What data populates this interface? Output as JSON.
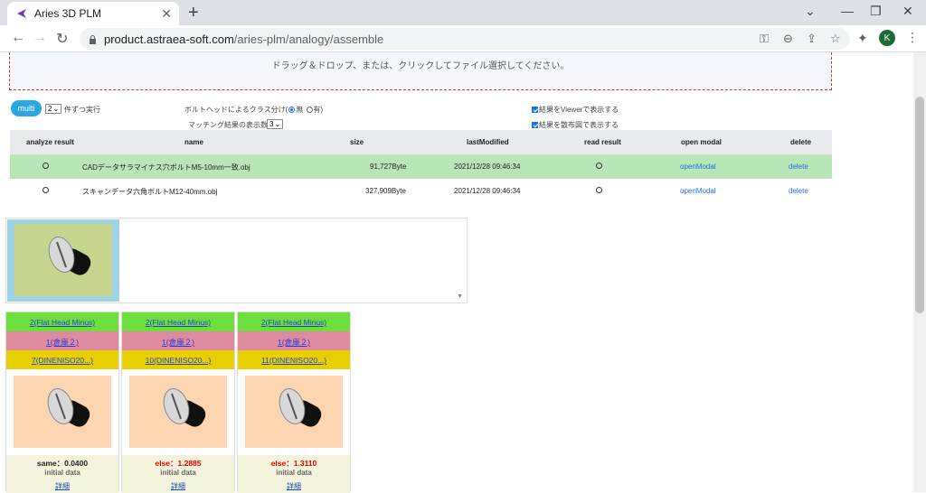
{
  "browser": {
    "tab_title": "Aries 3D PLM",
    "url_host": "product.astraea-soft.com",
    "url_path": "/aries-plm/analogy/assemble",
    "avatar_initial": "K"
  },
  "dropzone": {
    "text": "ドラッグ＆ドロップ、または、クリックしてファイル選択してください。"
  },
  "controls": {
    "multi_label": "multi",
    "batch_value": "2",
    "batch_suffix": "件ずつ実行",
    "bolt_head_label": "ボルトヘッドによるクラス分け(",
    "radio_no": "無",
    "radio_yes": "有",
    "radio_close": ")",
    "match_count_label": "マッチング結果の表示数:",
    "match_count_value": "3",
    "viewer_label": "結果をViewerで表示する",
    "scatter_label": "結果を散布図で表示する"
  },
  "table": {
    "headers": {
      "analyze": "analyze result",
      "name": "name",
      "size": "size",
      "modified": "lastModified",
      "read": "read result",
      "open": "open modal",
      "delete": "delete"
    },
    "rows": [
      {
        "name": "CADデータサラマイナス穴ボルトM5-10mm一致.obj",
        "size": "91,727Byte",
        "modified": "2021/12/28 09:46:34",
        "open": "openModal",
        "delete": "delete"
      },
      {
        "name": "スキャンデータ六角ボルトM12-40mm.obj",
        "size": "327,909Byte",
        "modified": "2021/12/28 09:46:34",
        "open": "openModal",
        "delete": "delete"
      }
    ]
  },
  "cards": [
    {
      "class": "2(Flat Head Minus)",
      "store": "1(倉庫２)",
      "std": "7(DINENISO20...)",
      "score": "same：0.0400",
      "note": "initial data",
      "detail": "詳細"
    },
    {
      "class": "2(Flat Head Minus)",
      "store": "1(倉庫２)",
      "std": "10(DINENISO20...)",
      "score": "else：1.2885",
      "note": "initial data",
      "detail": "詳細"
    },
    {
      "class": "2(Flat Head Minus)",
      "store": "1(倉庫２)",
      "std": "11(DINENISO20...)",
      "score": "else：1.3110",
      "note": "initial data",
      "detail": "詳細"
    }
  ]
}
